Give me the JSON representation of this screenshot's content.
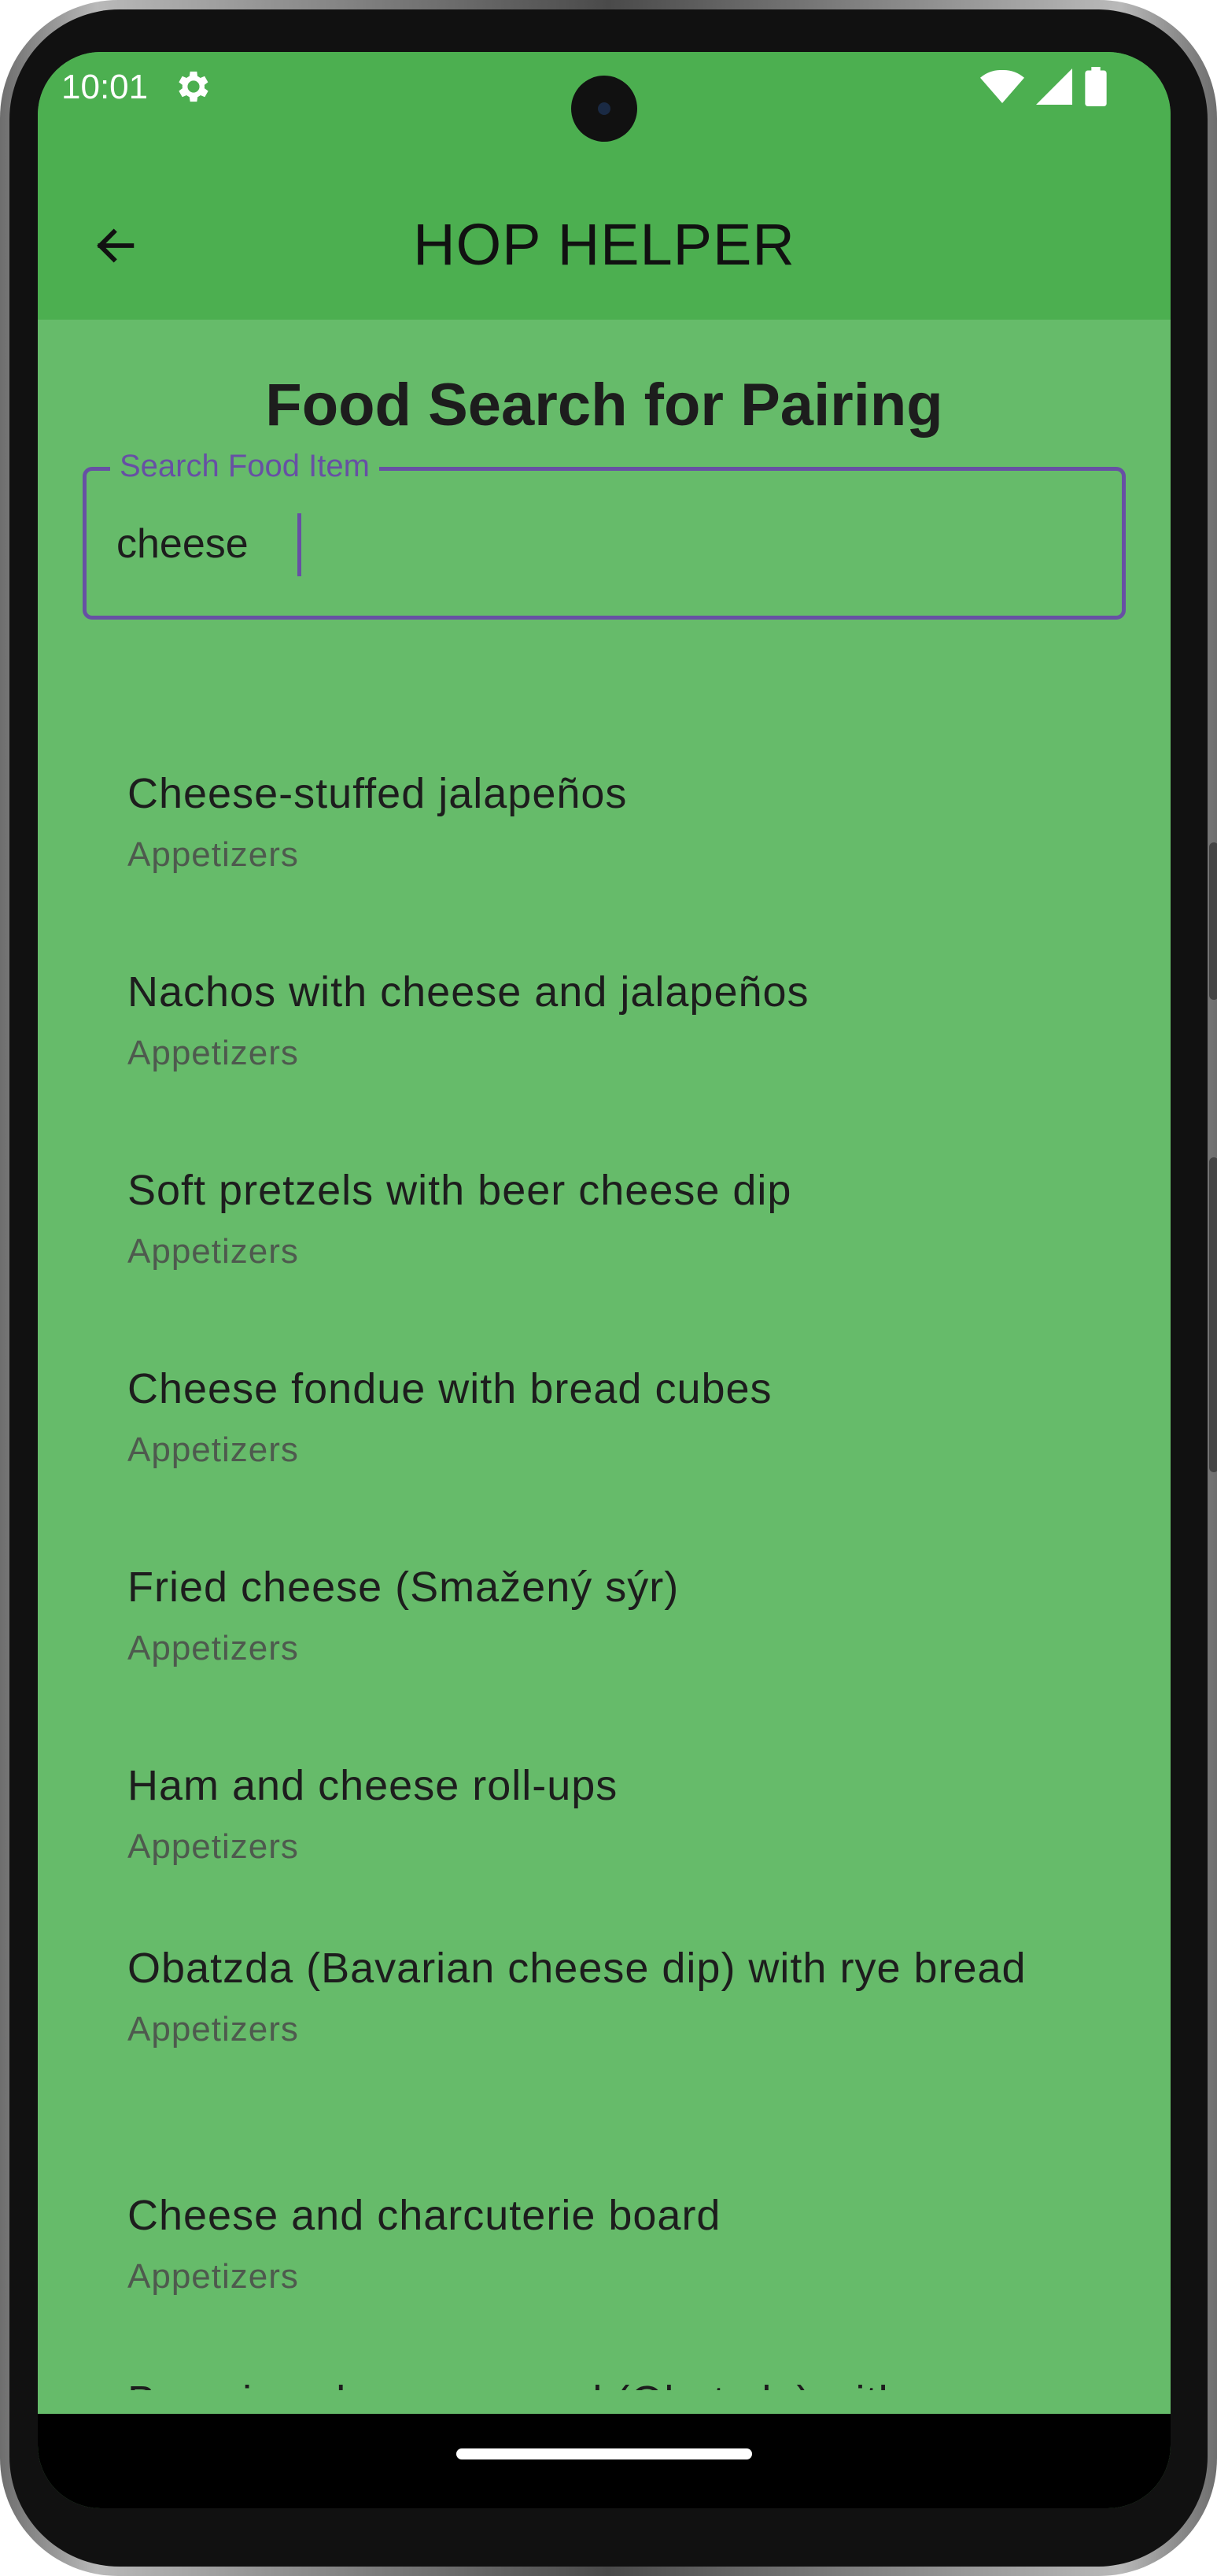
{
  "status": {
    "time": "10:01",
    "icons": [
      "settings-gear",
      "wifi",
      "cellular-signal",
      "battery"
    ]
  },
  "appbar": {
    "title": "HOP HELPER",
    "back_icon": "arrow-left"
  },
  "page": {
    "heading": "Food Search for Pairing"
  },
  "search": {
    "label": "Search Food Item",
    "value": "cheese",
    "accent_color": "#6750a4"
  },
  "results": [
    {
      "title": "Cheese-stuffed jalapeños",
      "category": "Appetizers"
    },
    {
      "title": "Nachos with cheese and jalapeños",
      "category": "Appetizers"
    },
    {
      "title": "Soft pretzels with beer cheese dip",
      "category": "Appetizers"
    },
    {
      "title": "Cheese fondue with bread cubes",
      "category": "Appetizers"
    },
    {
      "title": "Fried cheese (Smažený sýr)",
      "category": "Appetizers"
    },
    {
      "title": "Ham and cheese roll-ups",
      "category": "Appetizers"
    },
    {
      "title": "Obatzda (Bavarian cheese dip) with rye bread",
      "category": "Appetizers"
    },
    {
      "title": "Cheese and charcuterie board",
      "category": "Appetizers"
    },
    {
      "title": "Bavarian cheese spread (Obatzda) with rye",
      "category": ""
    }
  ],
  "colors": {
    "appbar": "#4caf50",
    "background": "#66bb6a",
    "accent": "#6750a4"
  }
}
